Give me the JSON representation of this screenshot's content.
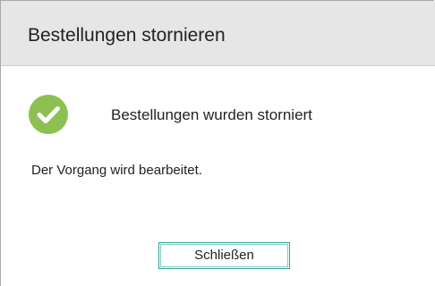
{
  "dialog": {
    "title": "Bestellungen stornieren",
    "status_message": "Bestellungen wurden storniert",
    "info_text": "Der Vorgang wird bearbeitet.",
    "close_label": "Schließen",
    "success_icon": "check-circle-icon"
  },
  "colors": {
    "titlebar_bg": "#e6e6e6",
    "success_green": "#8cc152",
    "button_border": "#2ea09c"
  }
}
